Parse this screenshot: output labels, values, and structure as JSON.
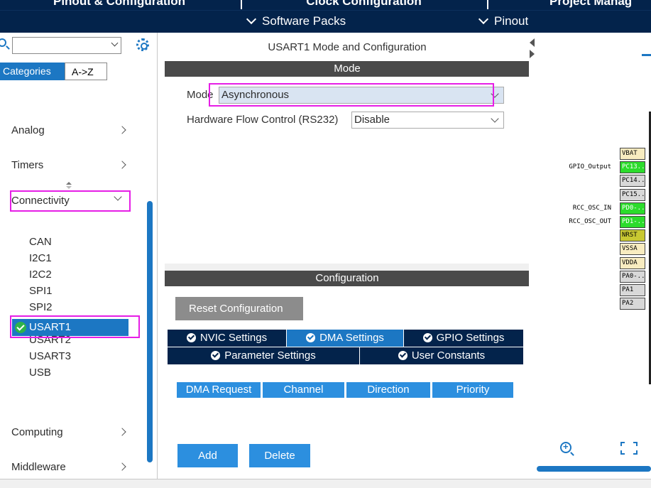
{
  "top_tabs": [
    "Pinout & Configuration",
    "Clock Configuration",
    "Project Manag"
  ],
  "sub_menu": {
    "software_packs": "Software Packs",
    "pinout": "Pinout"
  },
  "left_panel": {
    "search": {
      "value": ""
    },
    "category_tabs": [
      "Categories",
      "A->Z"
    ],
    "categories": [
      {
        "label": "Analog"
      },
      {
        "label": "Timers"
      },
      {
        "label": "Connectivity"
      },
      {
        "label": "Computing"
      },
      {
        "label": "Middleware"
      }
    ],
    "connectivity_items": [
      "CAN",
      "I2C1",
      "I2C2",
      "SPI1",
      "SPI2",
      "USART1",
      "USART2",
      "USART3",
      "USB"
    ],
    "selected_item": "USART1"
  },
  "middle_panel": {
    "title": "USART1 Mode and Configuration",
    "mode_header": "Mode",
    "mode_label": "Mode",
    "mode_value": "Asynchronous",
    "hfc_label": "Hardware Flow Control (RS232)",
    "hfc_value": "Disable",
    "config_header": "Configuration",
    "reset_button": "Reset Configuration",
    "tabs_row1": [
      "NVIC Settings",
      "DMA Settings",
      "GPIO Settings"
    ],
    "tabs_row2": [
      "Parameter Settings",
      "User Constants"
    ],
    "active_tab": "DMA Settings",
    "dma_columns": [
      "DMA Request",
      "Channel",
      "Direction",
      "Priority"
    ],
    "add_button": "Add",
    "delete_button": "Delete"
  },
  "pinout": {
    "pins": [
      {
        "name": "VBAT",
        "color": "yellow",
        "label": ""
      },
      {
        "name": "PC13..",
        "color": "green",
        "label": "GPIO_Output"
      },
      {
        "name": "PC14..",
        "color": "gray",
        "label": ""
      },
      {
        "name": "PC15..",
        "color": "gray",
        "label": ""
      },
      {
        "name": "PD0-..",
        "color": "green",
        "label": "RCC_OSC_IN"
      },
      {
        "name": "PD1-..",
        "color": "green",
        "label": "RCC_OSC_OUT"
      },
      {
        "name": "NRST",
        "color": "olive",
        "label": ""
      },
      {
        "name": "VSSA",
        "color": "yellow",
        "label": ""
      },
      {
        "name": "VDDA",
        "color": "yellow",
        "label": ""
      },
      {
        "name": "PA0-..",
        "color": "gray",
        "label": ""
      },
      {
        "name": "PA1",
        "color": "gray",
        "label": ""
      },
      {
        "name": "PA2",
        "color": "gray",
        "label": ""
      }
    ]
  },
  "colors": {
    "nav_dark": "#03234b",
    "accent_blue": "#1c77c3",
    "highlight_magenta": "#e61ee6",
    "pin_green": "#2cdc2c"
  }
}
